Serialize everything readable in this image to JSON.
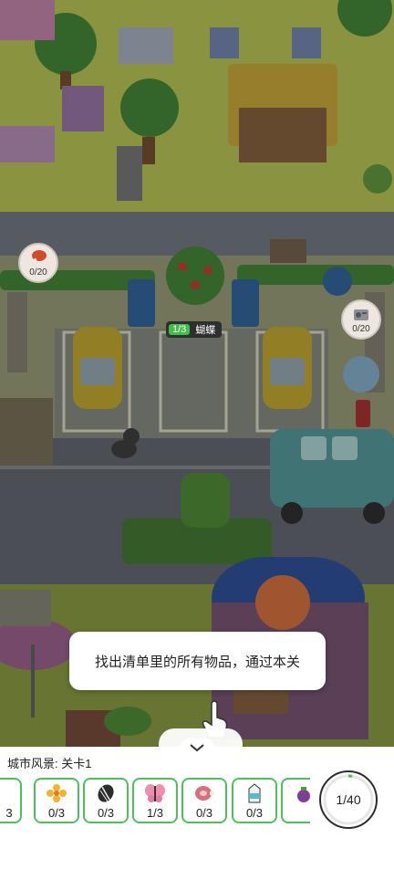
{
  "scene": {
    "left_bubble_count": "0/20",
    "right_bubble_count": "0/20",
    "found_tag": {
      "count": "1/3",
      "label": "蝴蝶"
    }
  },
  "tooltip": {
    "text": "找出清单里的所有物品，通过本关"
  },
  "panel": {
    "level_title": "城市风景: 关卡1",
    "items": [
      {
        "icon": "partial-item-icon",
        "count": "3"
      },
      {
        "icon": "flower-icon",
        "count": "0/3"
      },
      {
        "icon": "seed-icon",
        "count": "0/3"
      },
      {
        "icon": "butterfly-icon",
        "count": "1/3"
      },
      {
        "icon": "ham-icon",
        "count": "0/3"
      },
      {
        "icon": "milk-carton-icon",
        "count": "0/3"
      },
      {
        "icon": "eggplant-icon",
        "count": ""
      }
    ],
    "progress": {
      "found": 1,
      "total": 40,
      "label": "1/40"
    }
  },
  "colors": {
    "accent_green": "#4cc15a",
    "grass": "#c9df7a",
    "road": "#8f9aa5"
  }
}
